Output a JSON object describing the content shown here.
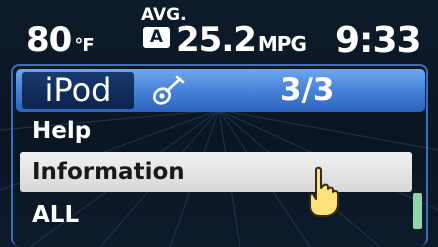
{
  "status": {
    "temperature": "80",
    "temperature_unit": "°F",
    "avg_label": "AVG.",
    "avg_badge": "A",
    "fuel_economy": "25.2",
    "fuel_unit": "MPG",
    "clock": "9:33"
  },
  "header": {
    "source": "iPod",
    "source_icon": "guitar-icon",
    "page_indicator": "3/3"
  },
  "menu": {
    "items": [
      {
        "label": "Help",
        "selected": false
      },
      {
        "label": "Information",
        "selected": true
      },
      {
        "label": "ALL",
        "selected": false
      }
    ]
  },
  "scroll": {
    "position_fraction": 0.75
  },
  "colors": {
    "header_blue": "#4a86db",
    "tab_navy": "#0c2350",
    "highlight": "#e6e6e6",
    "scroll_thumb": "#8fd6a6",
    "pointer_fill": "#ffe27a"
  }
}
